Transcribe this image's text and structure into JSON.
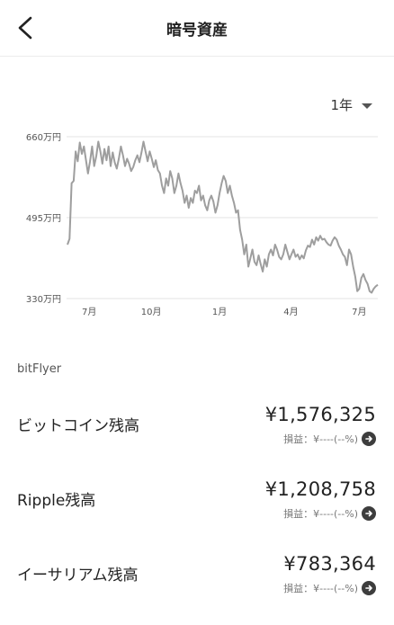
{
  "header": {
    "title": "暗号資産",
    "back_icon": "chevron-left-icon"
  },
  "period": {
    "selected": "1年"
  },
  "chart_data": {
    "type": "line",
    "y_tick_labels": [
      "660万円",
      "495万円",
      "330万円"
    ],
    "y_ticks": [
      660,
      495,
      330
    ],
    "ylim": [
      330,
      660
    ],
    "x_tick_labels": [
      "7月",
      "10月",
      "1月",
      "4月",
      "7月"
    ],
    "x_ticks": [
      0.07,
      0.27,
      0.49,
      0.72,
      0.94
    ],
    "line_color": "#9e9e9e",
    "grid": true,
    "points": [
      [
        0.0,
        440
      ],
      [
        0.006,
        452
      ],
      [
        0.012,
        565
      ],
      [
        0.018,
        570
      ],
      [
        0.024,
        630
      ],
      [
        0.03,
        610
      ],
      [
        0.036,
        648
      ],
      [
        0.042,
        625
      ],
      [
        0.048,
        640
      ],
      [
        0.054,
        612
      ],
      [
        0.06,
        585
      ],
      [
        0.066,
        610
      ],
      [
        0.072,
        640
      ],
      [
        0.078,
        600
      ],
      [
        0.084,
        620
      ],
      [
        0.09,
        650
      ],
      [
        0.096,
        630
      ],
      [
        0.102,
        605
      ],
      [
        0.108,
        635
      ],
      [
        0.114,
        612
      ],
      [
        0.12,
        640
      ],
      [
        0.126,
        600
      ],
      [
        0.132,
        628
      ],
      [
        0.138,
        608
      ],
      [
        0.144,
        595
      ],
      [
        0.15,
        615
      ],
      [
        0.156,
        640
      ],
      [
        0.162,
        622
      ],
      [
        0.168,
        600
      ],
      [
        0.174,
        615
      ],
      [
        0.18,
        605
      ],
      [
        0.186,
        590
      ],
      [
        0.192,
        598
      ],
      [
        0.198,
        612
      ],
      [
        0.204,
        622
      ],
      [
        0.21,
        608
      ],
      [
        0.216,
        628
      ],
      [
        0.222,
        650
      ],
      [
        0.228,
        630
      ],
      [
        0.234,
        610
      ],
      [
        0.24,
        630
      ],
      [
        0.246,
        615
      ],
      [
        0.252,
        598
      ],
      [
        0.258,
        612
      ],
      [
        0.264,
        592
      ],
      [
        0.27,
        585
      ],
      [
        0.276,
        560
      ],
      [
        0.282,
        545
      ],
      [
        0.288,
        575
      ],
      [
        0.294,
        560
      ],
      [
        0.3,
        590
      ],
      [
        0.306,
        575
      ],
      [
        0.312,
        545
      ],
      [
        0.318,
        560
      ],
      [
        0.324,
        585
      ],
      [
        0.33,
        565
      ],
      [
        0.336,
        550
      ],
      [
        0.342,
        525
      ],
      [
        0.348,
        540
      ],
      [
        0.354,
        515
      ],
      [
        0.36,
        535
      ],
      [
        0.366,
        525
      ],
      [
        0.372,
        550
      ],
      [
        0.378,
        545
      ],
      [
        0.384,
        560
      ],
      [
        0.39,
        530
      ],
      [
        0.396,
        540
      ],
      [
        0.402,
        520
      ],
      [
        0.408,
        510
      ],
      [
        0.414,
        530
      ],
      [
        0.42,
        540
      ],
      [
        0.426,
        528
      ],
      [
        0.432,
        505
      ],
      [
        0.438,
        520
      ],
      [
        0.444,
        545
      ],
      [
        0.45,
        565
      ],
      [
        0.456,
        580
      ],
      [
        0.462,
        570
      ],
      [
        0.468,
        545
      ],
      [
        0.474,
        560
      ],
      [
        0.48,
        540
      ],
      [
        0.486,
        525
      ],
      [
        0.492,
        505
      ],
      [
        0.498,
        510
      ],
      [
        0.504,
        470
      ],
      [
        0.51,
        450
      ],
      [
        0.516,
        420
      ],
      [
        0.522,
        440
      ],
      [
        0.528,
        395
      ],
      [
        0.534,
        412
      ],
      [
        0.54,
        430
      ],
      [
        0.546,
        405
      ],
      [
        0.552,
        398
      ],
      [
        0.558,
        418
      ],
      [
        0.564,
        400
      ],
      [
        0.57,
        385
      ],
      [
        0.576,
        410
      ],
      [
        0.582,
        395
      ],
      [
        0.588,
        420
      ],
      [
        0.594,
        430
      ],
      [
        0.6,
        418
      ],
      [
        0.606,
        440
      ],
      [
        0.612,
        430
      ],
      [
        0.618,
        415
      ],
      [
        0.624,
        410
      ],
      [
        0.63,
        420
      ],
      [
        0.636,
        440
      ],
      [
        0.642,
        425
      ],
      [
        0.648,
        410
      ],
      [
        0.654,
        420
      ],
      [
        0.66,
        430
      ],
      [
        0.666,
        415
      ],
      [
        0.672,
        420
      ],
      [
        0.678,
        410
      ],
      [
        0.684,
        418
      ],
      [
        0.69,
        412
      ],
      [
        0.696,
        428
      ],
      [
        0.702,
        438
      ],
      [
        0.708,
        435
      ],
      [
        0.714,
        450
      ],
      [
        0.72,
        440
      ],
      [
        0.726,
        455
      ],
      [
        0.732,
        448
      ],
      [
        0.738,
        458
      ],
      [
        0.744,
        450
      ],
      [
        0.75,
        452
      ],
      [
        0.756,
        445
      ],
      [
        0.762,
        440
      ],
      [
        0.768,
        438
      ],
      [
        0.774,
        448
      ],
      [
        0.78,
        455
      ],
      [
        0.786,
        450
      ],
      [
        0.792,
        438
      ],
      [
        0.798,
        430
      ],
      [
        0.804,
        420
      ],
      [
        0.81,
        415
      ],
      [
        0.816,
        398
      ],
      [
        0.822,
        430
      ],
      [
        0.828,
        420
      ],
      [
        0.834,
        395
      ],
      [
        0.84,
        375
      ],
      [
        0.846,
        345
      ],
      [
        0.852,
        350
      ],
      [
        0.858,
        372
      ],
      [
        0.864,
        380
      ],
      [
        0.87,
        368
      ],
      [
        0.876,
        360
      ],
      [
        0.882,
        345
      ],
      [
        0.888,
        342
      ],
      [
        0.894,
        350
      ],
      [
        0.9,
        355
      ],
      [
        0.906,
        358
      ]
    ]
  },
  "section": {
    "label": "bitFlyer"
  },
  "pl_label": "損益：¥----(--%)",
  "assets": [
    {
      "name": "ビットコイン残高",
      "amount": "¥1,576,325"
    },
    {
      "name": "Ripple残高",
      "amount": "¥1,208,758"
    },
    {
      "name": "イーサリアム残高",
      "amount": "¥783,364"
    }
  ]
}
